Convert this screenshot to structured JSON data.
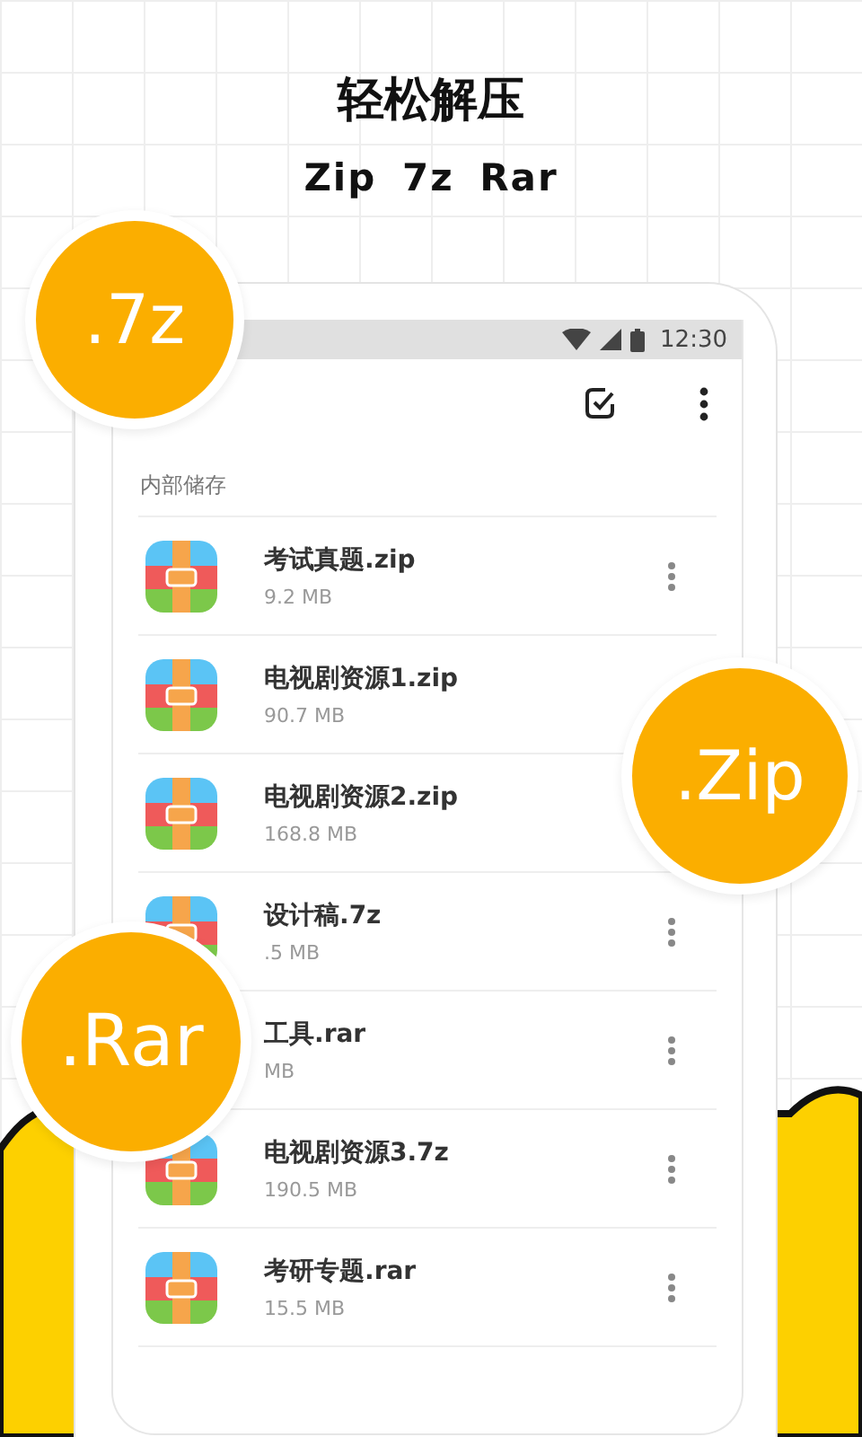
{
  "title": "轻松解压",
  "subtitle": "Zip 7z Rar",
  "badges": [
    ".7z",
    ".Zip",
    ".Rar"
  ],
  "status_bar": {
    "time": "12:30"
  },
  "section": "内部储存",
  "files": [
    {
      "name": "考试真题.zip",
      "size": "9.2 MB",
      "more_menu": true
    },
    {
      "name": "电视剧资源1.zip",
      "size": "90.7 MB",
      "more_menu": false
    },
    {
      "name": "电视剧资源2.zip",
      "size": "168.8 MB",
      "more_menu": false
    },
    {
      "name": "设计稿.7z",
      "size": ".5 MB",
      "more_menu": true
    },
    {
      "name": "工具.rar",
      "size": "MB",
      "more_menu": true
    },
    {
      "name": "电视剧资源3.7z",
      "size": "190.5 MB",
      "more_menu": true
    },
    {
      "name": "考研专题.rar",
      "size": "15.5 MB",
      "more_menu": true
    }
  ]
}
